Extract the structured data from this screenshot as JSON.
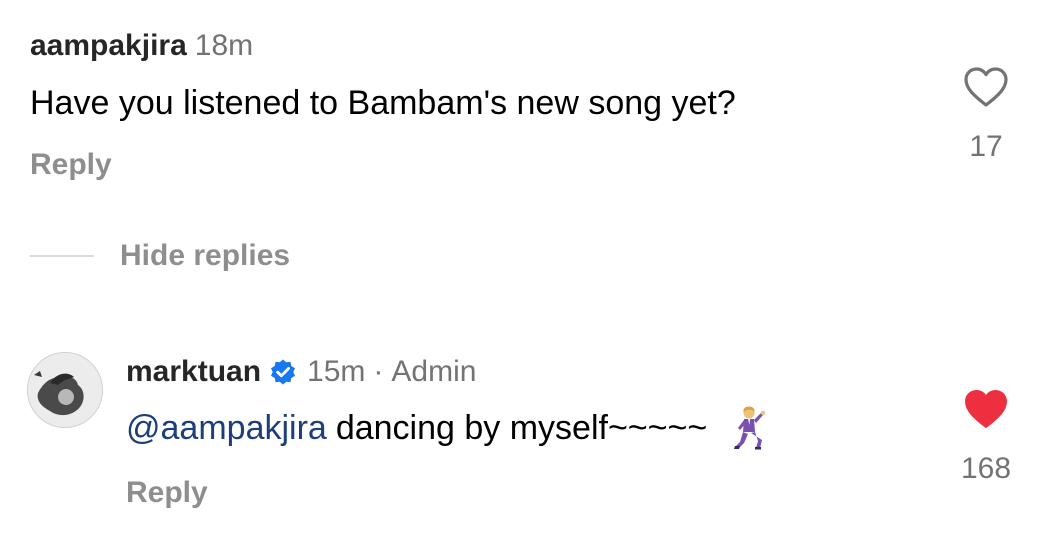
{
  "comment": {
    "username": "aampakjira",
    "time": "18m",
    "text": "Have you listened to Bambam's new song yet?",
    "reply_label": "Reply",
    "likes": "17",
    "liked": false
  },
  "thread": {
    "hide_replies_label": "Hide replies"
  },
  "reply": {
    "username": "marktuan",
    "verified": true,
    "time": "15m",
    "separator": "·",
    "role": "Admin",
    "mention": "@aampakjira",
    "text": "dancing by myself~~~~~",
    "emoji": "man-dancing-icon",
    "reply_label": "Reply",
    "likes": "168",
    "liked": true
  },
  "colors": {
    "like_red": "#ed2f3f",
    "verified_blue": "#1877f2",
    "mention_blue": "#1c3f7a",
    "muted_gray": "#8e8e8e"
  }
}
